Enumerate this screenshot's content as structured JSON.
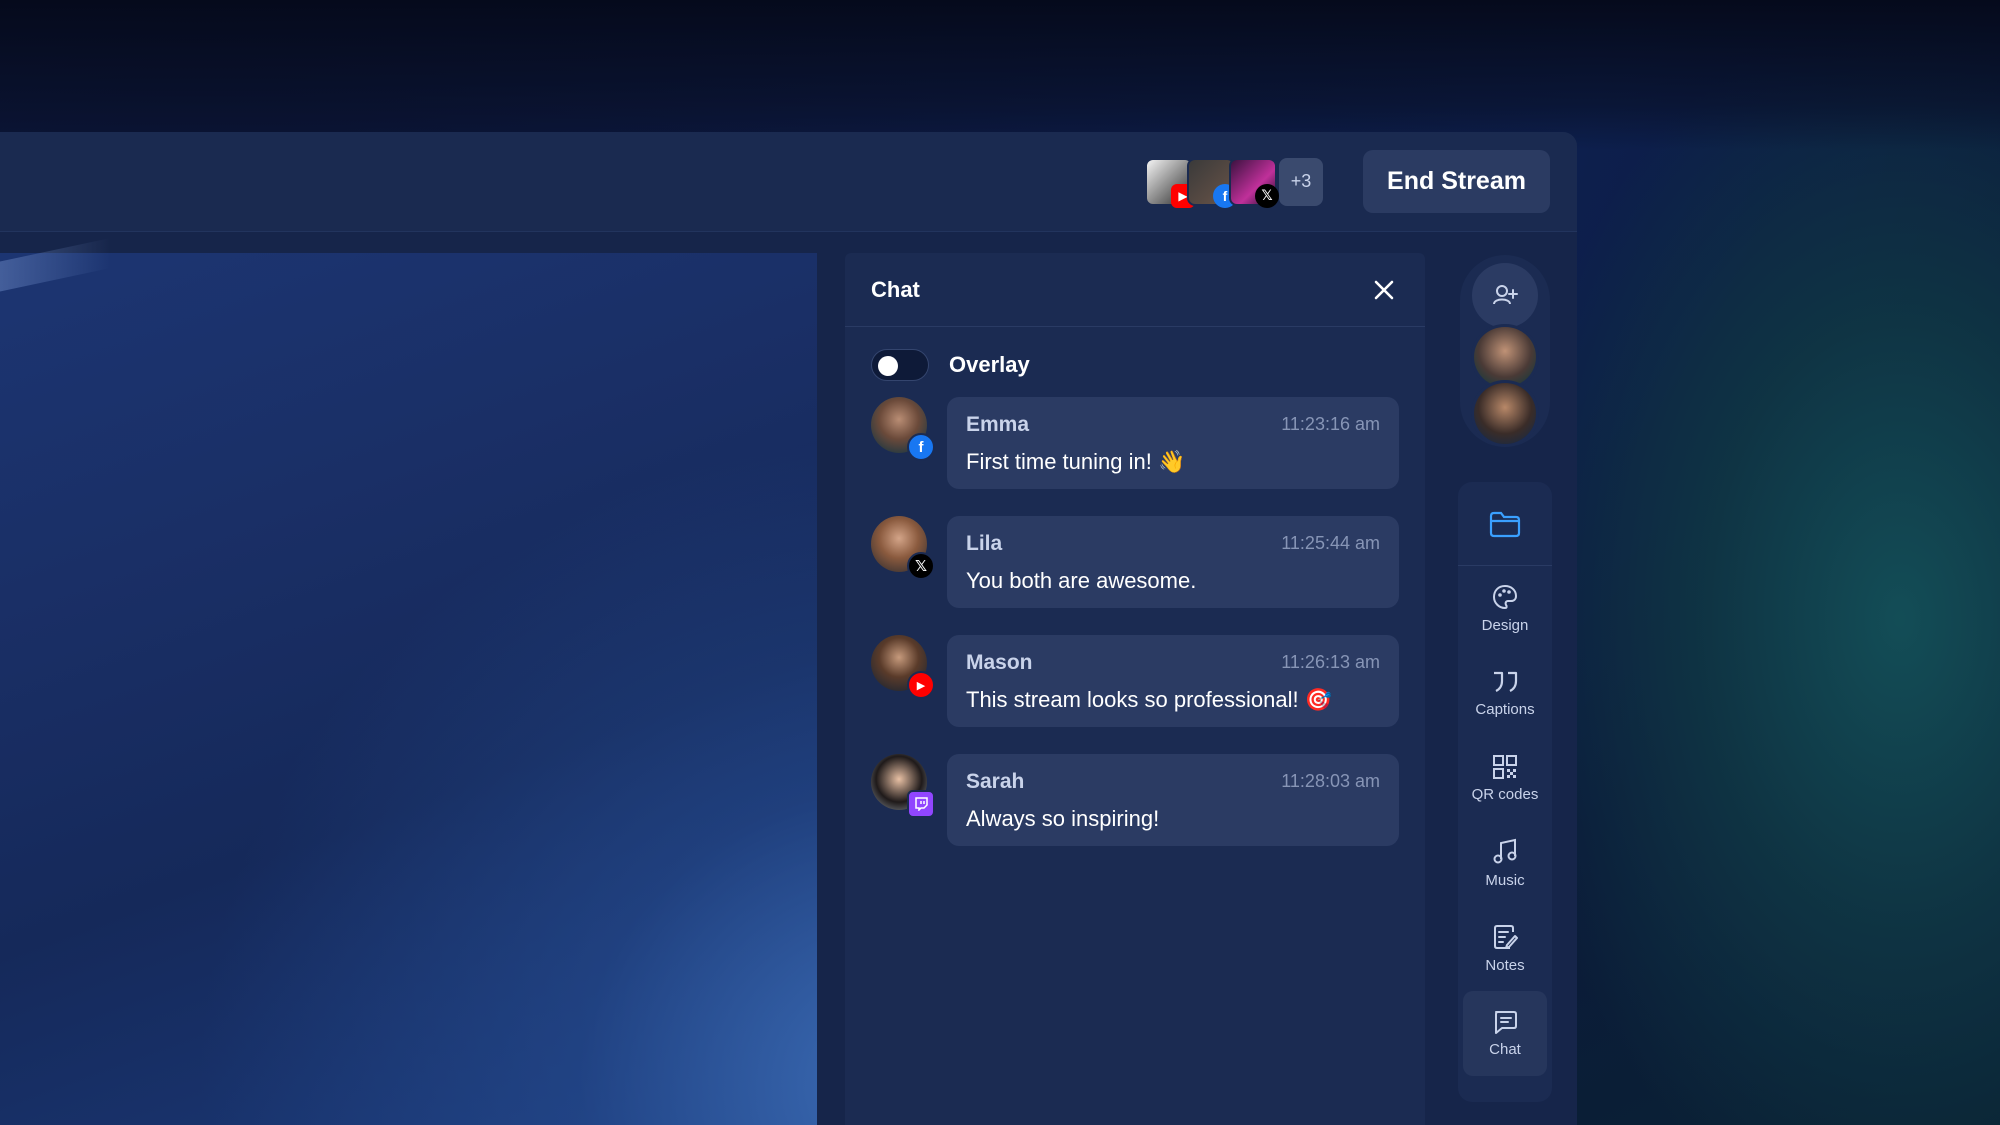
{
  "topbar": {
    "destinations": [
      {
        "platform": "youtube",
        "platform_color": "#ff0000"
      },
      {
        "platform": "facebook",
        "platform_color": "#1877f2"
      },
      {
        "platform": "x",
        "platform_color": "#000000"
      }
    ],
    "more_count": "+3",
    "end_stream_label": "End Stream"
  },
  "chat": {
    "title": "Chat",
    "overlay_label": "Overlay",
    "overlay_enabled": false,
    "messages": [
      {
        "name": "Emma",
        "time": "11:23:16 am",
        "text": "First time tuning in! 👋",
        "platform": "facebook",
        "platform_color": "#1877f2"
      },
      {
        "name": "Lila",
        "time": "11:25:44 am",
        "text": "You both are awesome.",
        "platform": "x",
        "platform_color": "#000000"
      },
      {
        "name": "Mason",
        "time": "11:26:13 am",
        "text": "This stream looks so professional! 🎯",
        "platform": "youtube",
        "platform_color": "#ff0000"
      },
      {
        "name": "Sarah",
        "time": "11:28:03 am",
        "text": "Always so inspiring!",
        "platform": "twitch",
        "platform_color": "#9146ff"
      }
    ]
  },
  "rail": {
    "tools": [
      {
        "label": "Design",
        "icon": "palette-icon"
      },
      {
        "label": "Captions",
        "icon": "quote-icon"
      },
      {
        "label": "QR codes",
        "icon": "qr-code-icon"
      },
      {
        "label": "Music",
        "icon": "music-note-icon"
      },
      {
        "label": "Notes",
        "icon": "notes-icon"
      },
      {
        "label": "Chat",
        "icon": "chat-icon"
      }
    ]
  },
  "colors": {
    "accent": "#3aa0ff",
    "panel": "#1b2b52",
    "bubble": "#2b3b63"
  }
}
